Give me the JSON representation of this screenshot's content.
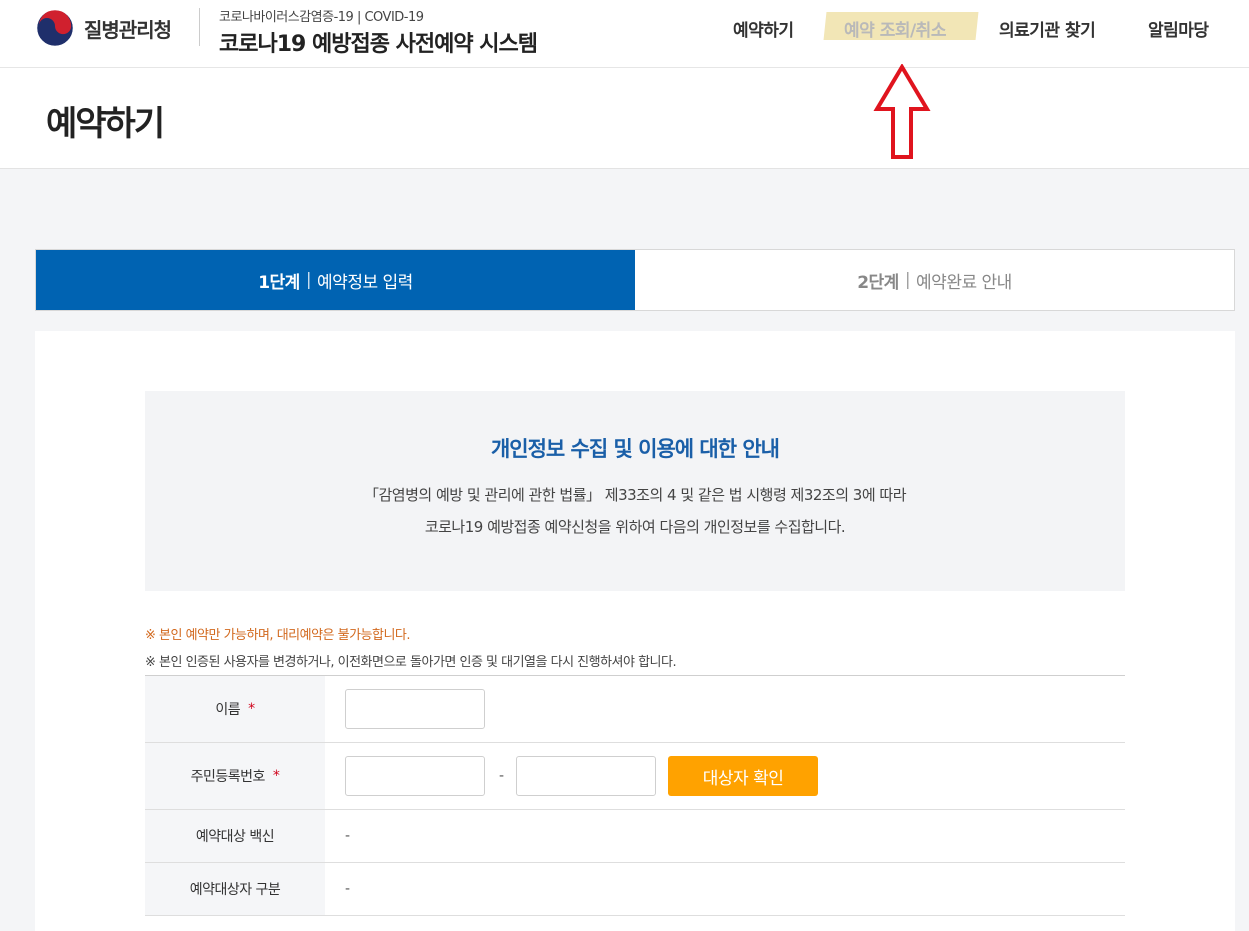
{
  "header": {
    "agency": "질병관리청",
    "system_sub": "코로나바이러스감염증-19 | COVID-19",
    "system_title": "코로나19 예방접종 사전예약 시스템",
    "nav": [
      {
        "label": "예약하기"
      },
      {
        "label": "예약 조회/취소"
      },
      {
        "label": "의료기관 찾기"
      },
      {
        "label": "알림마당"
      }
    ],
    "active_nav": "예약 조회/취소",
    "highlight_color": "#f2e6b6",
    "annotation_arrow_color": "#e0141e"
  },
  "page": {
    "title": "예약하기"
  },
  "steps": [
    {
      "num": "1단계",
      "sep": "|",
      "label": "예약정보 입력",
      "active": true
    },
    {
      "num": "2단계",
      "sep": "|",
      "label": "예약완료 안내",
      "active": false
    }
  ],
  "notice": {
    "title": "개인정보 수집 및 이용에 대한 안내",
    "line1": "「감염병의 예방 및 관리에 관한 법률」 제33조의 4 및 같은 법 시행령 제32조의 3에 따라",
    "line2": "코로나19 예방접종 예약신청을 위하여 다음의 개인정보를 수집합니다."
  },
  "warnings": {
    "w1": "※ 본인 예약만 가능하며, 대리예약은 불가능합니다.",
    "w2": "※ 본인 인증된 사용자를 변경하거나, 이전화면으로 돌아가면 인증 및 대기열을 다시 진행하셔야 합니다."
  },
  "form": {
    "name_label": "이름",
    "rrn_label": "주민등록번호",
    "required_mark": "*",
    "rrn_dash": "-",
    "check_button": "대상자 확인",
    "vaccine_label": "예약대상 백신",
    "vaccine_value": "-",
    "category_label": "예약대상자 구분",
    "category_value": "-"
  },
  "colors": {
    "primary": "#0063b2",
    "accent": "#ffa200",
    "notice_title": "#1a5fa8"
  }
}
